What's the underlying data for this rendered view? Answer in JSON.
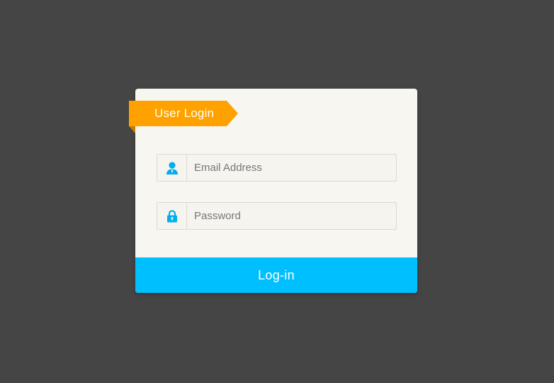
{
  "login_card": {
    "title": "User Login",
    "email": {
      "placeholder": "Email Address",
      "value": "",
      "icon": "user-icon"
    },
    "password": {
      "placeholder": "Password",
      "value": "",
      "icon": "lock-icon"
    },
    "submit_label": "Log-in"
  },
  "colors": {
    "background": "#454545",
    "card": "#f8f6f1",
    "ribbon": "#ffa200",
    "accent": "#00bfff",
    "icon": "#00aeef"
  }
}
